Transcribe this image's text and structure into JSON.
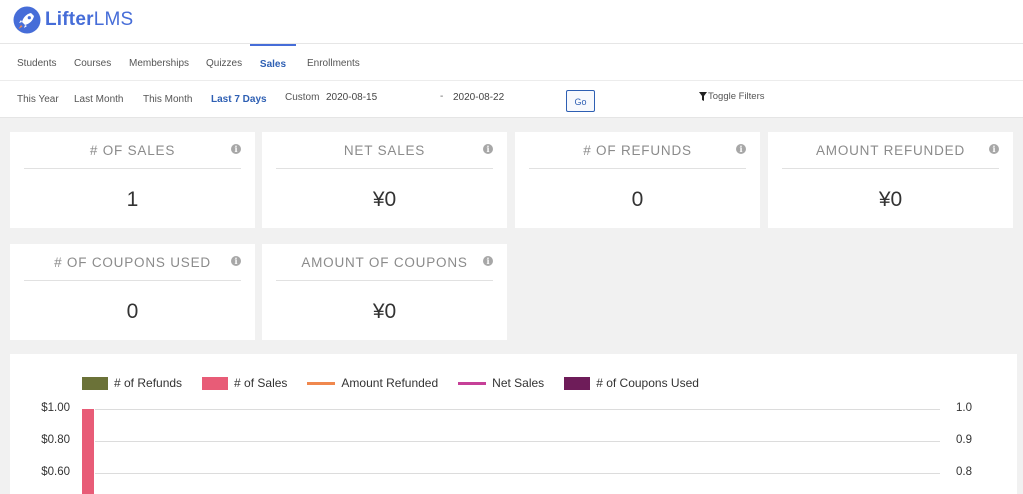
{
  "brand": {
    "name_bold": "Lifter",
    "name_light": "LMS"
  },
  "tabs": [
    {
      "label": "Students"
    },
    {
      "label": "Courses"
    },
    {
      "label": "Memberships"
    },
    {
      "label": "Quizzes"
    },
    {
      "label": "Sales",
      "active": true
    },
    {
      "label": "Enrollments"
    }
  ],
  "ranges": [
    {
      "label": "This Year"
    },
    {
      "label": "Last Month"
    },
    {
      "label": "This Month"
    },
    {
      "label": "Last 7 Days",
      "active": true
    },
    {
      "label": "Custom"
    }
  ],
  "filters": {
    "start_date": "2020-08-15",
    "separator": "-",
    "end_date": "2020-08-22",
    "go_label": "Go",
    "toggle_label": "Toggle Filters"
  },
  "widgets": [
    {
      "title": "# of Sales",
      "value": "1",
      "info": "i"
    },
    {
      "title": "Net Sales",
      "value": "¥0",
      "info": "i"
    },
    {
      "title": "# of Refunds",
      "value": "0",
      "info": "i"
    },
    {
      "title": "Amount Refunded",
      "value": "¥0",
      "info": "i"
    },
    {
      "title": "# of Coupons Used",
      "value": "0",
      "info": "i"
    },
    {
      "title": "Amount of Coupons",
      "value": "¥0",
      "info": "i"
    }
  ],
  "colors": {
    "accent": "#466dd8",
    "refunds": "#6b7238",
    "sales": "#e85c77",
    "amount_refunded": "#f0884e",
    "net_sales": "#c64098",
    "coupons_used": "#6e1c59"
  },
  "chart_data": {
    "type": "bar",
    "legend": [
      {
        "name": "# of Refunds",
        "style": "box",
        "color": "#6b7238"
      },
      {
        "name": "# of Sales",
        "style": "box",
        "color": "#e85c77"
      },
      {
        "name": "Amount Refunded",
        "style": "line",
        "color": "#f0884e"
      },
      {
        "name": "Net Sales",
        "style": "line",
        "color": "#c64098"
      },
      {
        "name": "# of Coupons Used",
        "style": "box",
        "color": "#6e1c59"
      }
    ],
    "y_left_ticks": [
      "$1.00",
      "$0.80",
      "$0.60"
    ],
    "y_right_ticks": [
      "1.0",
      "0.9",
      "0.8"
    ],
    "y_right_range": [
      0,
      1.0
    ],
    "series": [
      {
        "name": "# of Sales",
        "values": [
          1
        ]
      }
    ],
    "legend_position": "top",
    "grid": true
  }
}
